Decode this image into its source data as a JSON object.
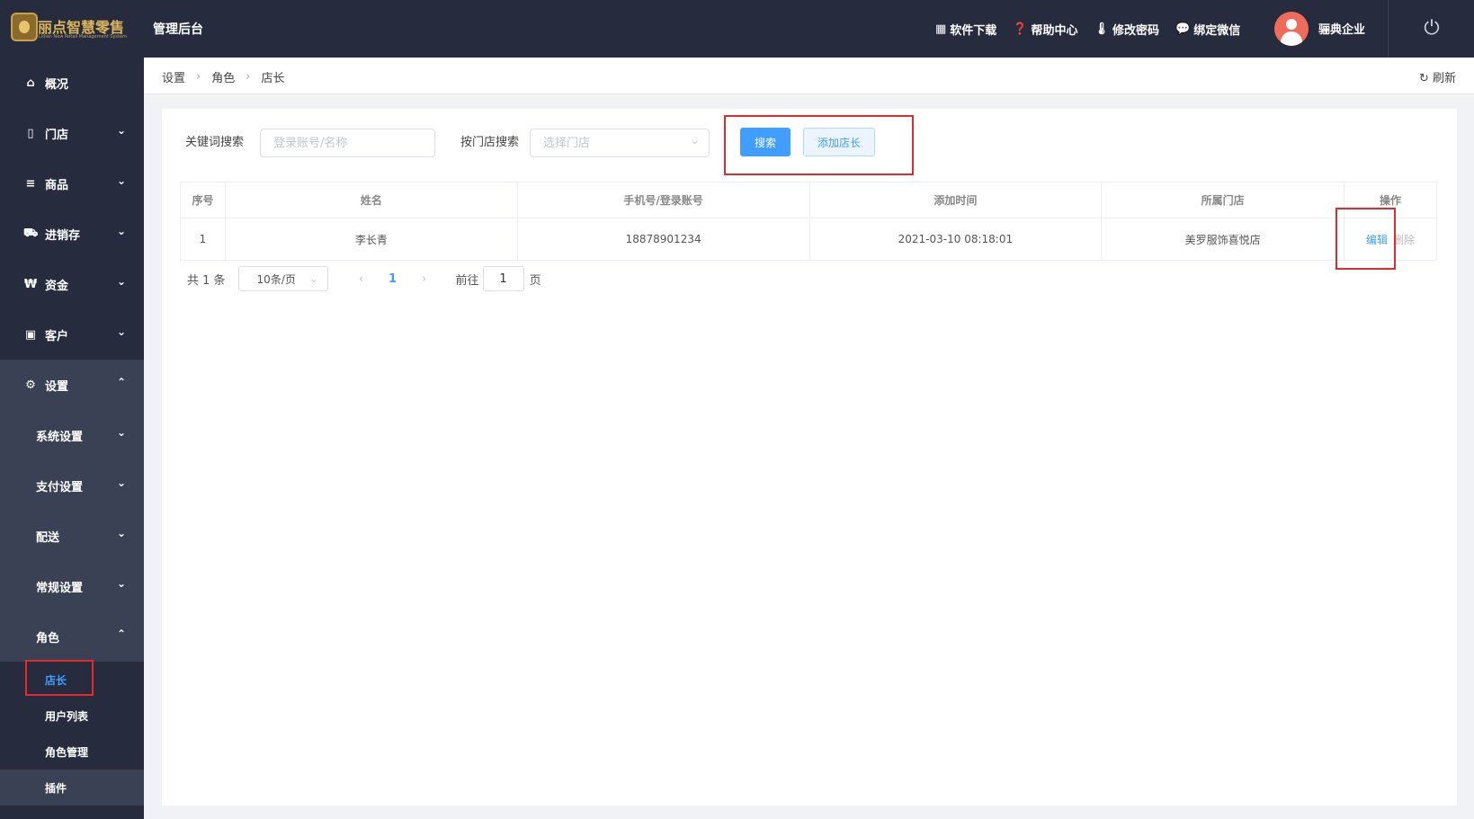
{
  "header": {
    "logo_title": "丽点智慧零售",
    "logo_subtitle": "Lidian New Retail Management System",
    "admin_title": "管理后台",
    "links": [
      {
        "icon": "store-icon",
        "glyph": "▦",
        "label": "软件下载"
      },
      {
        "icon": "help-icon",
        "glyph": "❓",
        "label": "帮助中心"
      },
      {
        "icon": "thermometer-icon",
        "glyph": "🌡",
        "label": "修改密码"
      },
      {
        "icon": "wechat-icon",
        "glyph": "💬",
        "label": "绑定微信"
      }
    ],
    "company": "骊典企业",
    "power_glyph": "⏻"
  },
  "sidebar": {
    "items": [
      {
        "label": "概况",
        "icon": "home-icon",
        "glyph": "⌂"
      },
      {
        "label": "门店",
        "icon": "document-icon",
        "glyph": "▯"
      },
      {
        "label": "商品",
        "icon": "menu-icon",
        "glyph": "≡"
      },
      {
        "label": "进销存",
        "icon": "truck-icon",
        "glyph": "⛟"
      },
      {
        "label": "资金",
        "icon": "won-icon",
        "glyph": "₩"
      },
      {
        "label": "客户",
        "icon": "id-card-icon",
        "glyph": "▣"
      },
      {
        "label": "设置",
        "icon": "gear-icon",
        "glyph": "⚙"
      }
    ],
    "sub_items": [
      {
        "label": "系统设置"
      },
      {
        "label": "支付设置"
      },
      {
        "label": "配送"
      },
      {
        "label": "常规设置"
      },
      {
        "label": "角色"
      }
    ],
    "leaves": [
      {
        "label": "店长",
        "active": true
      },
      {
        "label": "用户列表"
      },
      {
        "label": "角色管理"
      },
      {
        "label": "插件"
      }
    ],
    "chev_down": "⌄",
    "chev_up": "⌃"
  },
  "breadcrumb": {
    "items": [
      "设置",
      "角色",
      "店长"
    ],
    "refresh_label": "刷新"
  },
  "filters": {
    "keyword_label": "关键词搜索",
    "keyword_placeholder": "登录账号/名称",
    "store_label": "按门店搜索",
    "store_placeholder": "选择门店",
    "search_button": "搜索",
    "add_button": "添加店长"
  },
  "table": {
    "columns": [
      "序号",
      "姓名",
      "手机号/登录账号",
      "添加时间",
      "所属门店",
      "操作"
    ],
    "rows": [
      {
        "index": "1",
        "name": "李长青",
        "phone": "18878901234",
        "added": "2021-03-10 08:18:01",
        "store": "美罗服饰喜悦店",
        "edit": "编辑",
        "delete": "删除"
      }
    ]
  },
  "pagination": {
    "total": "共 1 条",
    "page_size": "10条/页",
    "current_page": "1",
    "goto_label": "前往",
    "goto_value": "1",
    "page_unit": "页"
  },
  "colors": {
    "dark_bg": "#262b3e",
    "accent": "#409eff",
    "highlight": "#e22b2b"
  }
}
